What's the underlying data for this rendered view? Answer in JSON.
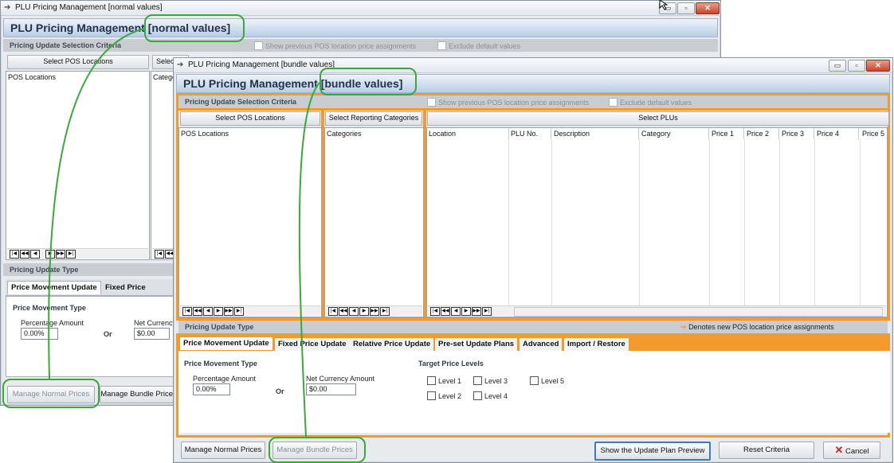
{
  "back_window": {
    "title": "PLU Pricing Management  [normal values]",
    "header_main": "PLU Pricing Management",
    "header_tag": "[normal values]",
    "criteria_label": "Pricing Update Selection Criteria",
    "show_prev": "Show previous POS location price assignments",
    "exclude_default": "Exclude default values",
    "select_pos_btn": "Select POS Locations",
    "select_cat_btn_partial": "Selec",
    "pos_list_header": "POS Locations",
    "cat_list_header_partial": "Catego",
    "update_type_label": "Pricing Update Type",
    "tab_price_movement": "Price Movement Update",
    "tab_fixed_price": "Fixed Price Update",
    "price_movement_type": "Price Movement Type",
    "percentage_amount": "Percentage Amount",
    "percentage_value": "0.00%",
    "or": "Or",
    "net_currency_partial": "Net Currency",
    "net_value": "$0.00",
    "manage_normal": "Manage Normal Prices",
    "manage_bundle": "Manage Bundle Prices"
  },
  "front_window": {
    "title": "PLU Pricing Management  [bundle values]",
    "header_main": "PLU Pricing Management",
    "header_tag": "[bundle values]",
    "criteria_label": "Pricing Update Selection Criteria",
    "show_prev": "Show previous POS location price assignments",
    "exclude_default": "Exclude default values",
    "select_pos_btn": "Select POS Locations",
    "select_cat_btn": "Select Reporting Categories",
    "select_plu_btn": "Select PLUs",
    "pos_list_header": "POS Locations",
    "cat_list_header": "Categories",
    "plu_columns": [
      "Location",
      "PLU No.",
      "Description",
      "Category",
      "Price 1",
      "Price 2",
      "Price 3",
      "Price 4",
      "Price 5"
    ],
    "update_type_label": "Pricing Update Type",
    "denotes_note": "Denotes new POS location price assignments",
    "tabs": [
      "Price Movement Update",
      "Fixed Price Update",
      "Relative Price Update",
      "Pre-set Update Plans",
      "Advanced",
      "Import / Restore"
    ],
    "price_movement_type": "Price Movement Type",
    "percentage_amount": "Percentage Amount",
    "percentage_value": "0.00%",
    "or": "Or",
    "net_currency": "Net Currency Amount",
    "net_value": "$0.00",
    "target_levels": "Target Price Levels",
    "levels": [
      "Level 1",
      "Level 2",
      "Level 3",
      "Level 4",
      "Level 5"
    ],
    "manage_normal": "Manage Normal Prices",
    "manage_bundle": "Manage Bundle Prices",
    "show_preview": "Show the Update Plan Preview",
    "reset": "Reset Criteria",
    "cancel": "Cancel"
  },
  "nav_glyphs": [
    "|◀",
    "◀◀",
    "◀",
    "▶",
    "▶▶",
    "▶|"
  ],
  "window_glyphs": {
    "minimize": "▭",
    "restore": "▫",
    "close": "✕"
  },
  "arrow_glyph": "➔",
  "colors": {
    "accent": "#f39a2c",
    "annotation": "#3aa93a",
    "header": "#23324a"
  }
}
